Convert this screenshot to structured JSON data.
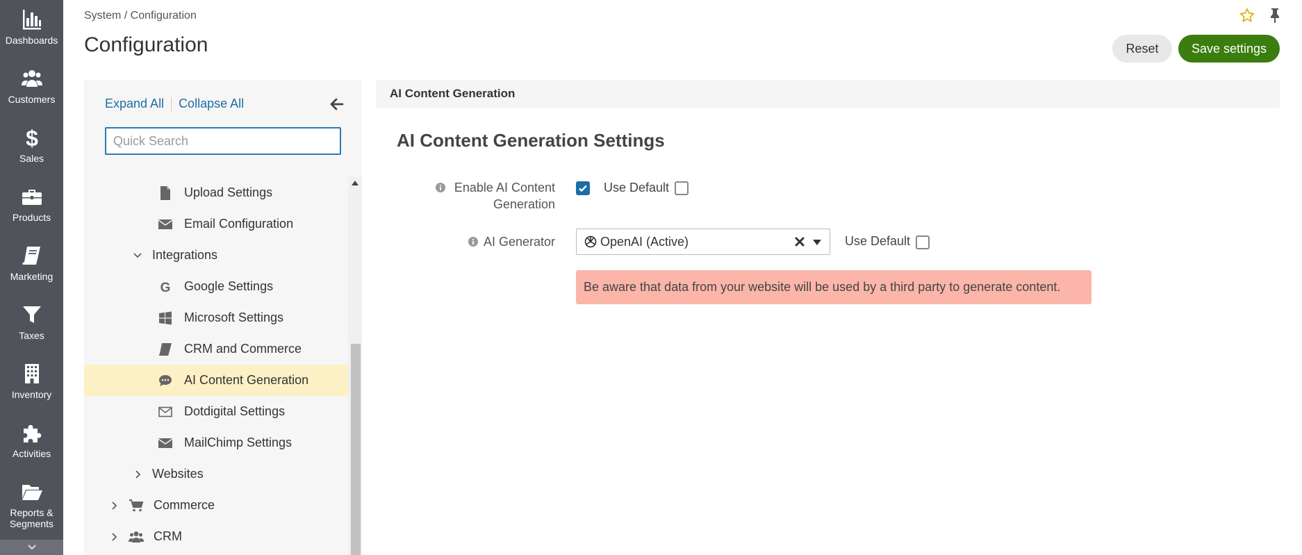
{
  "nav": {
    "items": [
      {
        "label": "Dashboards",
        "icon": "chart-bar-icon"
      },
      {
        "label": "Customers",
        "icon": "users-icon"
      },
      {
        "label": "Sales",
        "icon": "dollar-icon"
      },
      {
        "label": "Products",
        "icon": "briefcase-icon"
      },
      {
        "label": "Marketing",
        "icon": "book-icon"
      },
      {
        "label": "Taxes",
        "icon": "funnel-icon"
      },
      {
        "label": "Inventory",
        "icon": "building-icon"
      },
      {
        "label": "Activities",
        "icon": "puzzle-icon"
      },
      {
        "label": "Reports &\nSegments",
        "icon": "folder-open-icon"
      }
    ]
  },
  "header": {
    "breadcrumb": "System / Configuration",
    "title": "Configuration",
    "reset_label": "Reset",
    "save_label": "Save settings"
  },
  "tree": {
    "expand_all": "Expand All",
    "collapse_all": "Collapse All",
    "search_placeholder": "Quick Search",
    "items": [
      {
        "label": "Upload Settings",
        "icon": "file-icon"
      },
      {
        "label": "Email Configuration",
        "icon": "envelope-icon"
      },
      {
        "label": "Integrations",
        "icon": "chevron-down-icon"
      },
      {
        "label": "Google Settings",
        "icon": "google-icon"
      },
      {
        "label": "Microsoft Settings",
        "icon": "windows-icon"
      },
      {
        "label": "CRM and Commerce",
        "icon": "book-icon"
      },
      {
        "label": "AI Content Generation",
        "icon": "comment-dots-icon"
      },
      {
        "label": "Dotdigital Settings",
        "icon": "envelope-outline-icon"
      },
      {
        "label": "MailChimp Settings",
        "icon": "envelope-icon"
      },
      {
        "label": "Websites",
        "icon": "chevron-right-icon"
      },
      {
        "label": "Commerce",
        "icon": "cart-icon"
      },
      {
        "label": "CRM",
        "icon": "users-icon"
      }
    ]
  },
  "content": {
    "section_header": "AI Content Generation",
    "settings_title": "AI Content Generation Settings",
    "enable_label": "Enable AI Content Generation",
    "generator_label": "AI Generator",
    "use_default": "Use Default",
    "generator_value": "OpenAI (Active)",
    "alert": "Be aware that data from your website will be used by a third party to generate content."
  },
  "colors": {
    "nav_bg": "#50535a",
    "save_button": "#3b7d0f",
    "link": "#1b6ea3",
    "active_item": "#fcf0c5",
    "alert_bg": "#fbb6a9"
  }
}
